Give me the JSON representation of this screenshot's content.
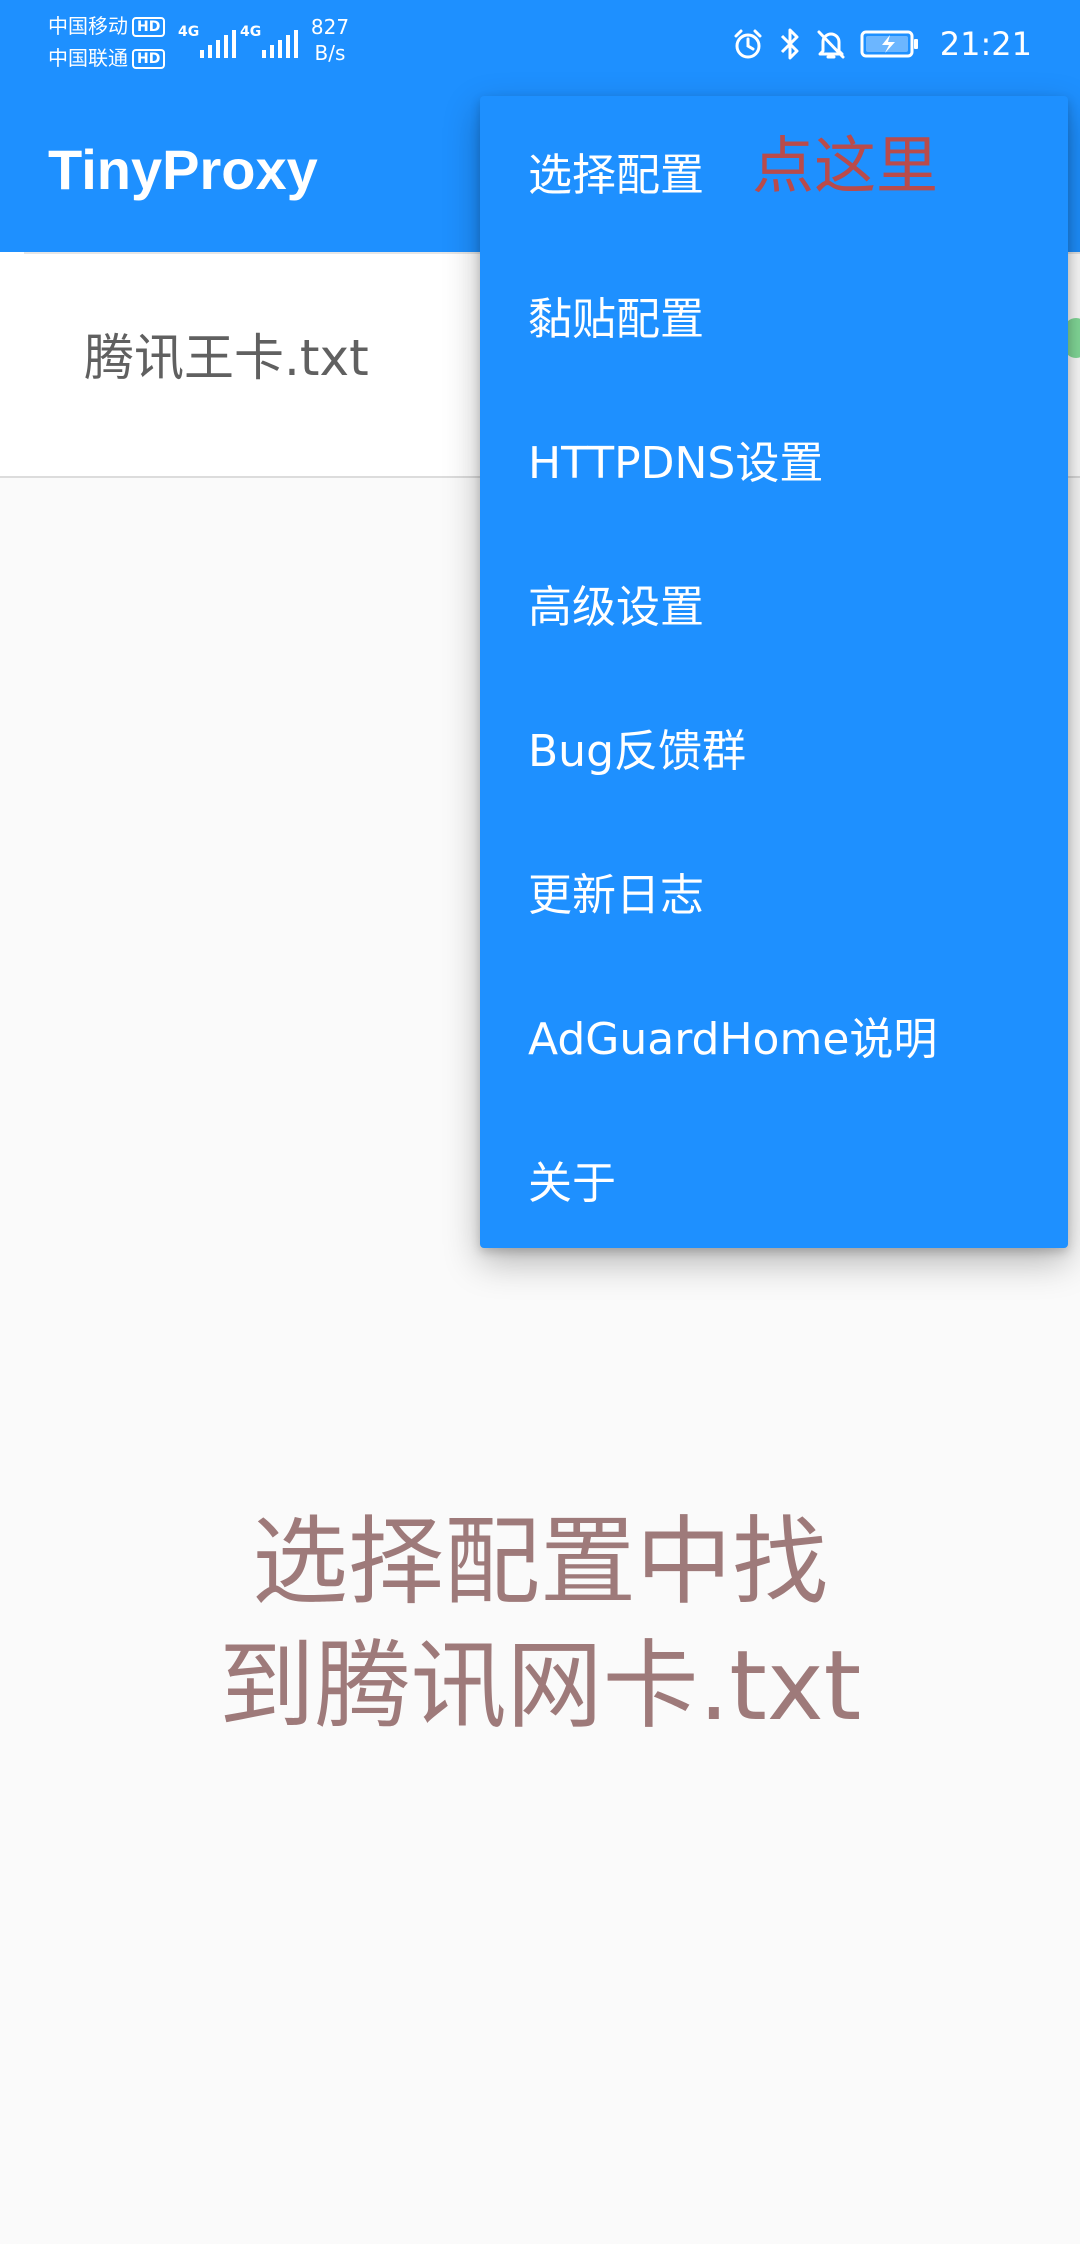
{
  "status_bar": {
    "carrier1": "中国移动",
    "carrier2": "中国联通",
    "hd_badge": "HD",
    "network1": "4G",
    "network2": "4G",
    "speed_value": "827",
    "speed_unit": "B/s",
    "time": "21:21",
    "icons": [
      "alarm-icon",
      "bluetooth-icon",
      "bell-muted-icon",
      "battery-charging-icon"
    ]
  },
  "app": {
    "title": "TinyProxy"
  },
  "list": {
    "file_name": "腾讯王卡.txt"
  },
  "menu": {
    "items": [
      "选择配置",
      "黏贴配置",
      "HTTPDNS设置",
      "高级设置",
      "Bug反馈群",
      "更新日志",
      "AdGuardHome说明",
      "关于"
    ],
    "hint": "点这里"
  },
  "instruction": {
    "line1": "选择配置中找",
    "line2": "到腾讯网卡.txt"
  },
  "colors": {
    "primary": "#1e90ff",
    "hint_red": "#b94b4b",
    "instruction_text": "#9e7a7a"
  }
}
